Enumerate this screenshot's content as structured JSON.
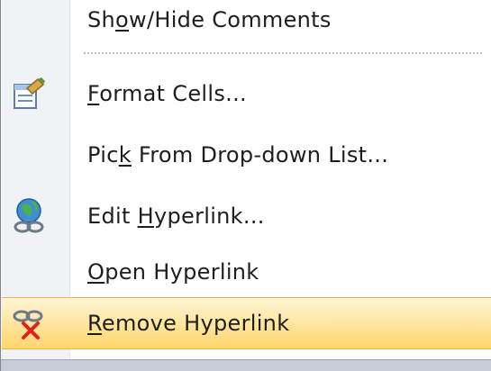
{
  "menu": {
    "items": [
      {
        "pre": "Sh",
        "key": "o",
        "post": "w/Hide Comments",
        "icon": ""
      },
      {
        "pre": "",
        "key": "F",
        "post": "ormat Cells...",
        "icon": "format-cells-icon"
      },
      {
        "pre": "Pic",
        "key": "k",
        "post": " From Drop-down List...",
        "icon": ""
      },
      {
        "pre": "Edit ",
        "key": "H",
        "post": "yperlink...",
        "icon": "edit-hyperlink-icon"
      },
      {
        "pre": "",
        "key": "O",
        "post": "pen Hyperlink",
        "icon": ""
      },
      {
        "pre": "",
        "key": "R",
        "post": "emove Hyperlink",
        "icon": "remove-hyperlink-icon"
      }
    ]
  },
  "colors": {
    "highlight": "#ffe7a6",
    "gutter": "#f0f2f5",
    "text": "#1e1e1e"
  }
}
